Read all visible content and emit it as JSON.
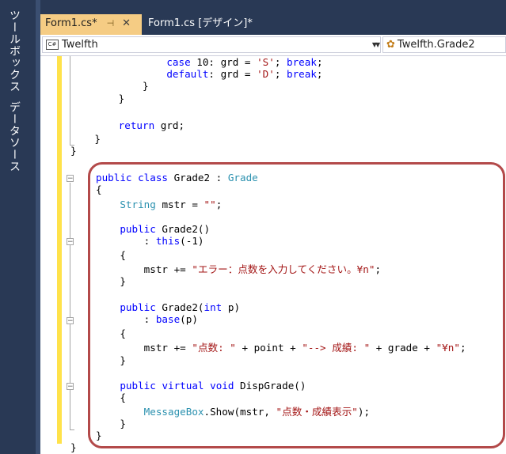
{
  "sidebar": {
    "toolbox_label": "ツールボックス",
    "datasource_label": "データソース"
  },
  "tabs": [
    {
      "label": "Form1.cs*",
      "pin_icon": "pin-icon",
      "close_icon": "close-icon",
      "active": true
    },
    {
      "label": "Form1.cs [デザイン]*",
      "active": false
    }
  ],
  "navbar": {
    "project_combo": {
      "icon": "C#",
      "value": "Twelfth"
    },
    "class_combo": {
      "value": "Twelfth.Grade2"
    }
  },
  "code_lines": [
    "                case 10: grd = 'S'; break;",
    "                default: grd = 'D'; break;",
    "            }",
    "        }",
    "",
    "        return grd;",
    "    }",
    "}",
    "",
    "public class Grade2 : Grade",
    "{",
    "    String mstr = \"\";",
    "",
    "    public Grade2()",
    "        : this(-1)",
    "    {",
    "        mstr += \"エラー：点数を入力してください。¥n\";",
    "    }",
    "",
    "    public Grade2(int p)",
    "        : base(p)",
    "    {",
    "        mstr += \"点数: \" + point + \"--> 成績: \" + grade + \"¥n\";",
    "    }",
    "",
    "    public virtual void DispGrade()",
    "    {",
    "        MessageBox.Show(mstr, \"点数・成績表示\");",
    "    }",
    "}",
    "}"
  ],
  "colors": {
    "keyword": "#0000ff",
    "type": "#2b91af",
    "string": "#a31515",
    "highlight_border": "#b34a4a",
    "active_tab": "#f5cc84",
    "sidebar": "#293955"
  }
}
